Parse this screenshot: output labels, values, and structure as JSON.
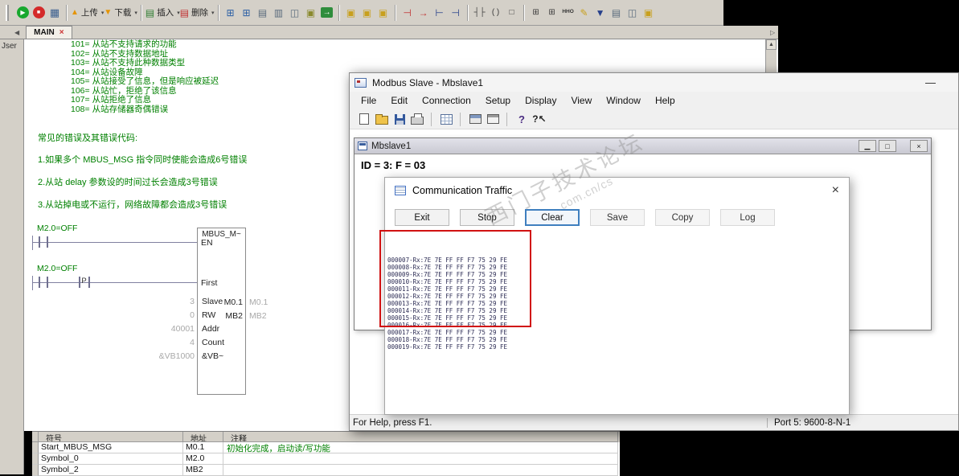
{
  "colors": {
    "annotation_red": "#d11212",
    "comment_green": "#008000",
    "traffic_text": "#2c2c54",
    "focus_blue": "#3f7fbf"
  },
  "step7": {
    "sidebar_label": "Jser",
    "tab": {
      "prev": "◀",
      "name": "MAIN",
      "close": "×",
      "next": "▷",
      "scroll_up": "▲"
    },
    "toolbar": {
      "items": [
        {
          "name": "run-icon",
          "cls": "t-run",
          "glyph": "▶"
        },
        {
          "name": "stop-icon",
          "cls": "t-stop",
          "glyph": "■"
        },
        {
          "name": "compile-icon",
          "cls": "t-comp",
          "glyph": "▦"
        },
        {
          "name": "toolbar-separator",
          "cls": "sep"
        },
        {
          "name": "upload-button",
          "cls": "t-up",
          "glyph": "▲",
          "label": "上传",
          "caret": "▾"
        },
        {
          "name": "download-button",
          "cls": "t-down",
          "glyph": "▼",
          "label": "下载",
          "caret": "▾"
        },
        {
          "name": "toolbar-separator",
          "cls": "sep"
        },
        {
          "name": "insert-button",
          "cls": "t-ins",
          "glyph": "▤",
          "label": "插入",
          "caret": "▾"
        },
        {
          "name": "delete-button",
          "cls": "t-del",
          "glyph": "▤",
          "label": "删除",
          "caret": "▾"
        },
        {
          "name": "toolbar-separator",
          "cls": "sep"
        },
        {
          "name": "symbol-table-icon",
          "cls": "t-blue",
          "glyph": "⊞"
        },
        {
          "name": "status-chart-icon",
          "cls": "t-blue",
          "glyph": "⊞"
        },
        {
          "name": "data-block-icon",
          "cls": "t-slate",
          "glyph": "▤"
        },
        {
          "name": "system-block-icon",
          "cls": "t-slate",
          "glyph": "▥"
        },
        {
          "name": "cross-reference-icon",
          "cls": "t-slate",
          "glyph": "◫"
        },
        {
          "name": "program-block-icon",
          "cls": "t-olive",
          "glyph": "▣"
        },
        {
          "name": "communications-icon",
          "cls": "t-comm",
          "glyph": "→"
        },
        {
          "name": "toolbar-separator",
          "cls": "sep"
        },
        {
          "name": "pack-project-icon",
          "cls": "t-gold",
          "glyph": "▣"
        },
        {
          "name": "protect-icon",
          "cls": "t-gold",
          "glyph": "▣"
        },
        {
          "name": "archive-icon",
          "cls": "t-gold",
          "glyph": "▣"
        },
        {
          "name": "toolbar-separator",
          "cls": "sep"
        },
        {
          "name": "insert-network-icon",
          "cls": "t-red",
          "glyph": "⊣"
        },
        {
          "name": "delete-network-icon",
          "cls": "t-red",
          "glyph": "→"
        },
        {
          "name": "insert-row-icon",
          "cls": "t-navy",
          "glyph": "⊢"
        },
        {
          "name": "delete-row-icon",
          "cls": "t-navy",
          "glyph": "⊣"
        },
        {
          "name": "toolbar-separator",
          "cls": "sep"
        },
        {
          "name": "contact-icon",
          "cls": "t-dark",
          "glyph": "┤├"
        },
        {
          "name": "coil-icon",
          "cls": "t-dark",
          "glyph": "( )"
        },
        {
          "name": "box-icon",
          "cls": "t-dark",
          "glyph": "□"
        },
        {
          "name": "toolbar-separator",
          "cls": "sep"
        },
        {
          "name": "address-grid-icon",
          "cls": "t-dark",
          "glyph": "⊞"
        },
        {
          "name": "grid-edit-icon",
          "cls": "t-dark",
          "glyph": "⊞"
        },
        {
          "name": "hex-toggle-icon",
          "cls": "t-hex",
          "glyph": "HHO"
        },
        {
          "name": "edit-icon",
          "cls": "t-gold",
          "glyph": "✎"
        },
        {
          "name": "bookmark-icon",
          "cls": "t-navy",
          "glyph": "▼"
        },
        {
          "name": "options-icon",
          "cls": "t-slate",
          "glyph": "▤"
        },
        {
          "name": "pou-icon",
          "cls": "t-slate",
          "glyph": "◫"
        },
        {
          "name": "library-icon",
          "cls": "t-gold",
          "glyph": "▣"
        }
      ]
    },
    "comments": {
      "codes": [
        "101= 从站不支持请求的功能",
        "102= 从站不支持数据地址",
        "103= 从站不支持此种数据类型",
        "104= 从站设备故障",
        "105= 从站接受了信息，但是响应被延迟",
        "106= 从站忙，拒绝了该信息",
        "107= 从站拒绝了信息",
        "108= 从站存储器奇偶错误"
      ],
      "title": "常见的错误及其错误代码:",
      "notes": [
        "1.如果多个 MBUS_MSG 指令同时使能会造成6号错误",
        "2.从站 delay 参数设的时间过长会造成3号错误",
        "3.从站掉电或不运行，网络故障都会造成3号错误"
      ]
    },
    "ladder": {
      "rung1_operand": "M2.0=OFF",
      "rung2_operand": "M2.0=OFF",
      "edge": "P",
      "box_title": "MBUS_M~",
      "en": "EN",
      "first": "First",
      "inputs": [
        {
          "value": "3",
          "pin": "Slave"
        },
        {
          "value": "0",
          "pin": "RW"
        },
        {
          "value": "40001",
          "pin": "Addr"
        },
        {
          "value": "4",
          "pin": "Count"
        },
        {
          "value": "&VB1000",
          "pin": "&VB~"
        }
      ],
      "outputs": [
        {
          "pin": "M0.1",
          "value": "M0.1"
        },
        {
          "pin": "MB2",
          "value": "MB2"
        }
      ]
    },
    "symbol_table": {
      "headers": [
        "符号",
        "地址",
        "注释"
      ],
      "rows": [
        {
          "symbol": "Start_MBUS_MSG",
          "address": "M0.1",
          "comment": "初始化完成，启动读/写功能"
        },
        {
          "symbol": "Symbol_0",
          "address": "M2.0",
          "comment": ""
        },
        {
          "symbol": "Symbol_2",
          "address": "MB2",
          "comment": ""
        }
      ]
    }
  },
  "modbus": {
    "title": "Modbus Slave - Mbslave1",
    "minimize": "—",
    "menu": [
      "File",
      "Edit",
      "Connection",
      "Setup",
      "Display",
      "View",
      "Window",
      "Help"
    ],
    "toolbar_items": [
      {
        "name": "new-file-icon",
        "cls": "mi-new"
      },
      {
        "name": "open-file-icon",
        "cls": "mi-open"
      },
      {
        "name": "save-icon",
        "cls": "mi-save"
      },
      {
        "name": "print-icon",
        "cls": "mi-print"
      },
      {
        "name": "toolbar-separator",
        "cls": "sep"
      },
      {
        "name": "display-setup-icon",
        "cls": "mi-grid"
      },
      {
        "name": "toolbar-separator",
        "cls": "sep"
      },
      {
        "name": "poll-definition-icon",
        "cls": "mi-term"
      },
      {
        "name": "comm-log-icon",
        "cls": "mi-term2"
      },
      {
        "name": "toolbar-separator",
        "cls": "sep"
      },
      {
        "name": "help-icon",
        "cls": "mi-help",
        "glyph": "?"
      },
      {
        "name": "context-help-icon",
        "cls": "mi-help2",
        "glyph": "?↖"
      }
    ],
    "status_left": "For Help, press F1.",
    "status_right": "Port 5: 9600-8-N-1",
    "child": {
      "title": "Mbslave1",
      "buttons": [
        {
          "name": "minimize-button",
          "glyph": "▁"
        },
        {
          "name": "maximize-button",
          "glyph": "□"
        },
        {
          "name": "close-button",
          "glyph": "×"
        }
      ],
      "id_line": "ID = 3: F = 03"
    }
  },
  "dialog": {
    "title": "Communication Traffic",
    "close": "×",
    "buttons": [
      {
        "name": "exit-button",
        "label": "Exit",
        "cls": "b-plain"
      },
      {
        "name": "stop-button",
        "label": "Stop",
        "cls": "b-plain"
      },
      {
        "name": "clear-button",
        "label": "Clear",
        "cls": "b-focus"
      },
      {
        "name": "save-button",
        "label": "Save",
        "cls": "b-light"
      },
      {
        "name": "copy-button",
        "label": "Copy",
        "cls": "b-light"
      },
      {
        "name": "log-button",
        "label": "Log",
        "cls": "b-light"
      }
    ],
    "traffic": [
      "000007-Rx:7E 7E FF FF F7 75 29 FE",
      "000008-Rx:7E 7E FF FF F7 75 29 FE",
      "000009-Rx:7E 7E FF FF F7 75 29 FE",
      "000010-Rx:7E 7E FF FF F7 75 29 FE",
      "000011-Rx:7E 7E FF FF F7 75 29 FE",
      "000012-Rx:7E 7E FF FF F7 75 29 FE",
      "000013-Rx:7E 7E FF FF F7 75 29 FE",
      "000014-Rx:7E 7E FF FF F7 75 29 FE",
      "000015-Rx:7E 7E FF FF F7 75 29 FE",
      "000016-Rx:7E 7E FF FF F7 75 29 FE",
      "000017-Rx:7E 7E FF FF F7 75 29 FE",
      "000018-Rx:7E 7E FF FF F7 75 29 FE",
      "000019-Rx:7E 7E FF FF F7 75 29 FE"
    ]
  },
  "watermark": {
    "line1": "西门子技术论坛",
    "line2": ".com.cn/cs"
  }
}
